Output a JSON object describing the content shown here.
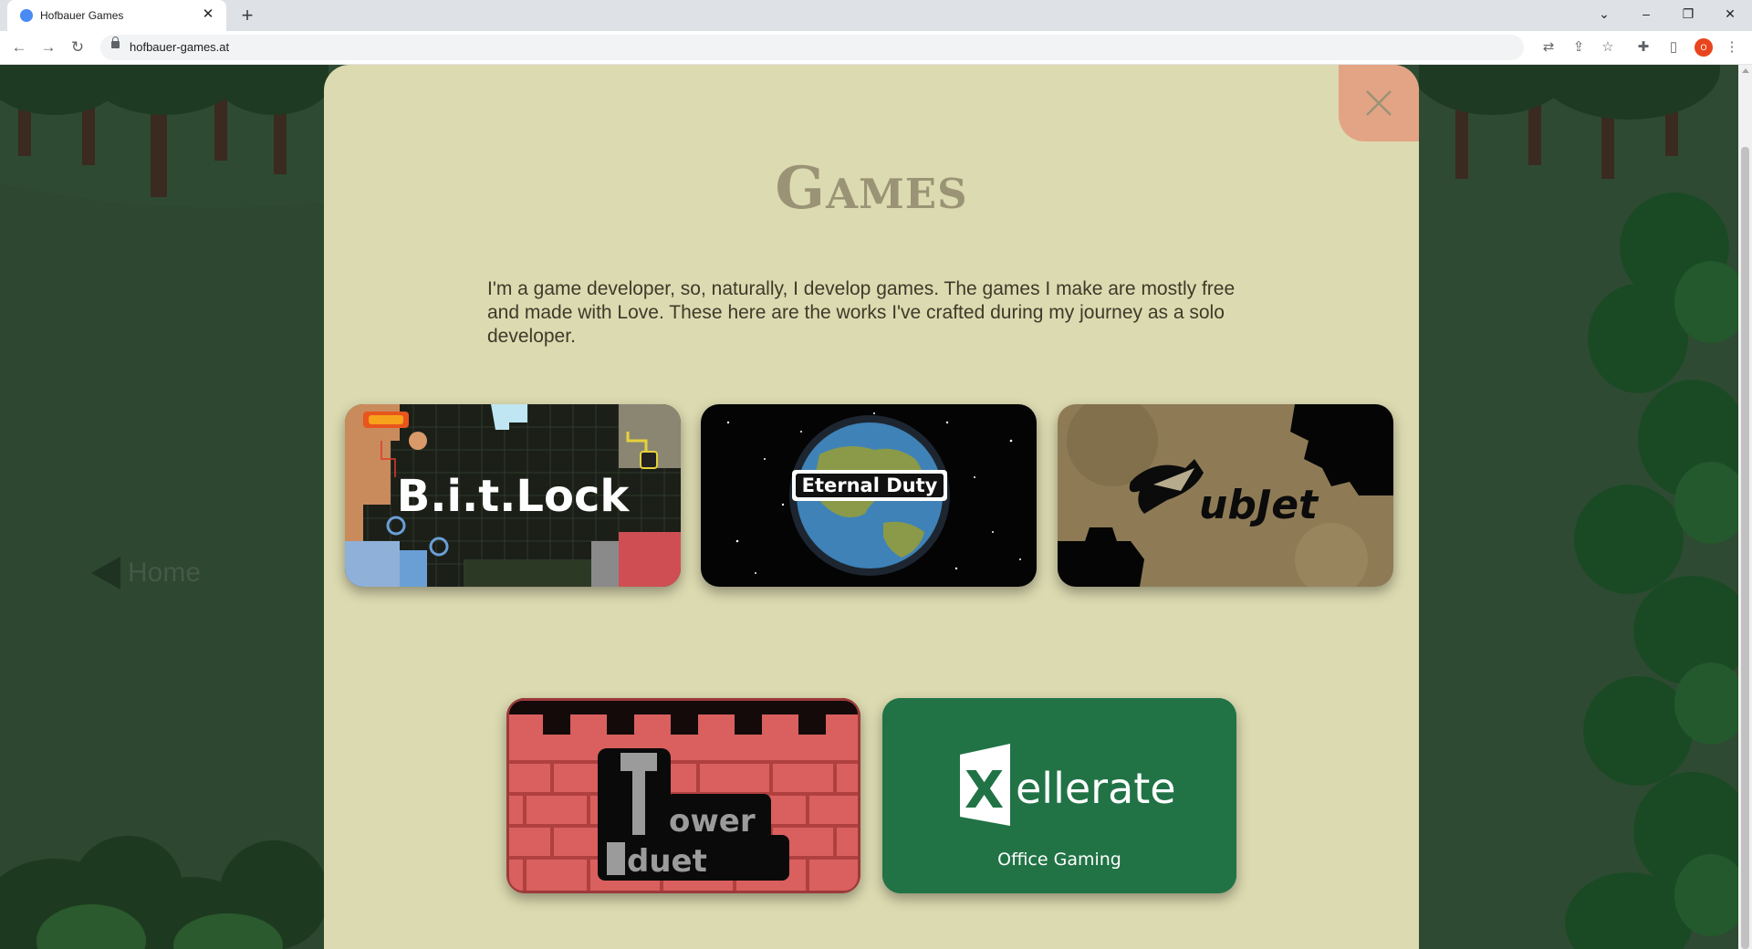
{
  "browser": {
    "tab_title": "Hofbauer Games",
    "tab_close": "✕",
    "new_tab": "+",
    "url": "hofbauer-games.at",
    "avatar_initials": "O",
    "window_controls": [
      "⌄",
      "–",
      "❐",
      "✕"
    ]
  },
  "page": {
    "home_link": "Home",
    "title": "Games",
    "intro": "I'm a game developer, so, naturally, I develop games. The games I make are mostly free and made with Love. These here are the works I've crafted during my journey as a solo developer.",
    "close_symbol": "✕"
  },
  "games": [
    {
      "name": "B.i.t.Lock",
      "logo_text": "B.i.t.Lock"
    },
    {
      "name": "Eternal Duty",
      "logo_text": "Eternal Duty"
    },
    {
      "name": "Subjet",
      "logo_text": "ubJet"
    },
    {
      "name": "Tower Duet",
      "logo_text_1": "ower",
      "logo_text_2": "duet"
    },
    {
      "name": "Xellerate",
      "logo_letter": "X",
      "logo_text": "ellerate",
      "subtitle": "Office Gaming"
    }
  ],
  "colors": {
    "modal_bg": "#dcdab0",
    "close_bg": "#e3a486",
    "title": "#9a9375",
    "forest": "#2f4a33",
    "xellerate_green": "#217346",
    "tower_red": "#d9605e"
  },
  "icons": {
    "back": "back-arrow-icon",
    "forward": "forward-arrow-icon",
    "reload": "reload-icon",
    "lock": "lock-icon",
    "translate": "translate-icon",
    "share": "share-icon",
    "bookmark": "star-icon",
    "extensions": "puzzle-icon",
    "sidepanel": "side-panel-icon",
    "menu": "kebab-menu-icon"
  }
}
